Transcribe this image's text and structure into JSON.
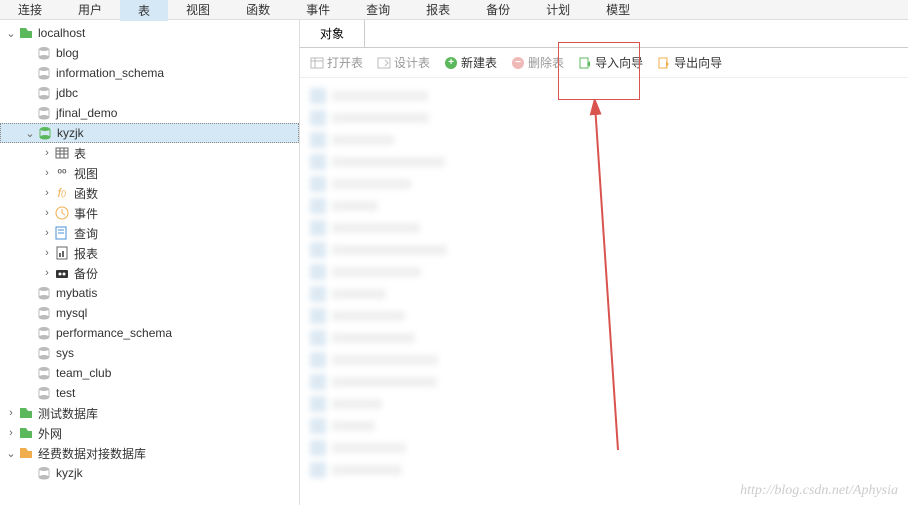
{
  "top_tabs": {
    "items": [
      "连接",
      "用户",
      "表",
      "视图",
      "函数",
      "事件",
      "查询",
      "报表",
      "备份",
      "计划",
      "模型"
    ],
    "active_index": 2
  },
  "sidebar": {
    "nodes": [
      {
        "level": 0,
        "expanded": true,
        "icon": "conn-green",
        "label": "localhost"
      },
      {
        "level": 1,
        "expanded": null,
        "icon": "db-gray",
        "label": "blog"
      },
      {
        "level": 1,
        "expanded": null,
        "icon": "db-gray",
        "label": "information_schema"
      },
      {
        "level": 1,
        "expanded": null,
        "icon": "db-gray",
        "label": "jdbc"
      },
      {
        "level": 1,
        "expanded": null,
        "icon": "db-gray",
        "label": "jfinal_demo"
      },
      {
        "level": 1,
        "expanded": true,
        "icon": "db-green",
        "label": "kyzjk",
        "selected": true
      },
      {
        "level": 2,
        "expanded": false,
        "icon": "table",
        "label": "表"
      },
      {
        "level": 2,
        "expanded": false,
        "icon": "view",
        "label": "视图"
      },
      {
        "level": 2,
        "expanded": false,
        "icon": "fx",
        "label": "函数"
      },
      {
        "level": 2,
        "expanded": false,
        "icon": "event",
        "label": "事件"
      },
      {
        "level": 2,
        "expanded": false,
        "icon": "query",
        "label": "查询"
      },
      {
        "level": 2,
        "expanded": false,
        "icon": "report",
        "label": "报表"
      },
      {
        "level": 2,
        "expanded": false,
        "icon": "backup",
        "label": "备份"
      },
      {
        "level": 1,
        "expanded": null,
        "icon": "db-gray",
        "label": "mybatis"
      },
      {
        "level": 1,
        "expanded": null,
        "icon": "db-gray",
        "label": "mysql"
      },
      {
        "level": 1,
        "expanded": null,
        "icon": "db-gray",
        "label": "performance_schema"
      },
      {
        "level": 1,
        "expanded": null,
        "icon": "db-gray",
        "label": "sys"
      },
      {
        "level": 1,
        "expanded": null,
        "icon": "db-gray",
        "label": "team_club"
      },
      {
        "level": 1,
        "expanded": null,
        "icon": "db-gray",
        "label": "test"
      },
      {
        "level": 0,
        "expanded": false,
        "icon": "conn-green",
        "label": "测试数据库"
      },
      {
        "level": 0,
        "expanded": false,
        "icon": "conn-green",
        "label": "外网"
      },
      {
        "level": 0,
        "expanded": true,
        "icon": "conn-orange",
        "label": "经费数据对接数据库"
      },
      {
        "level": 1,
        "expanded": null,
        "icon": "db-gray",
        "label": "kyzjk"
      }
    ]
  },
  "content": {
    "obj_tab": "对象",
    "toolbar": {
      "open": "打开表",
      "design": "设计表",
      "new": "新建表",
      "delete": "删除表",
      "import": "导入向导",
      "export": "导出向导"
    }
  },
  "watermark": "http://blog.csdn.net/Aphysia"
}
